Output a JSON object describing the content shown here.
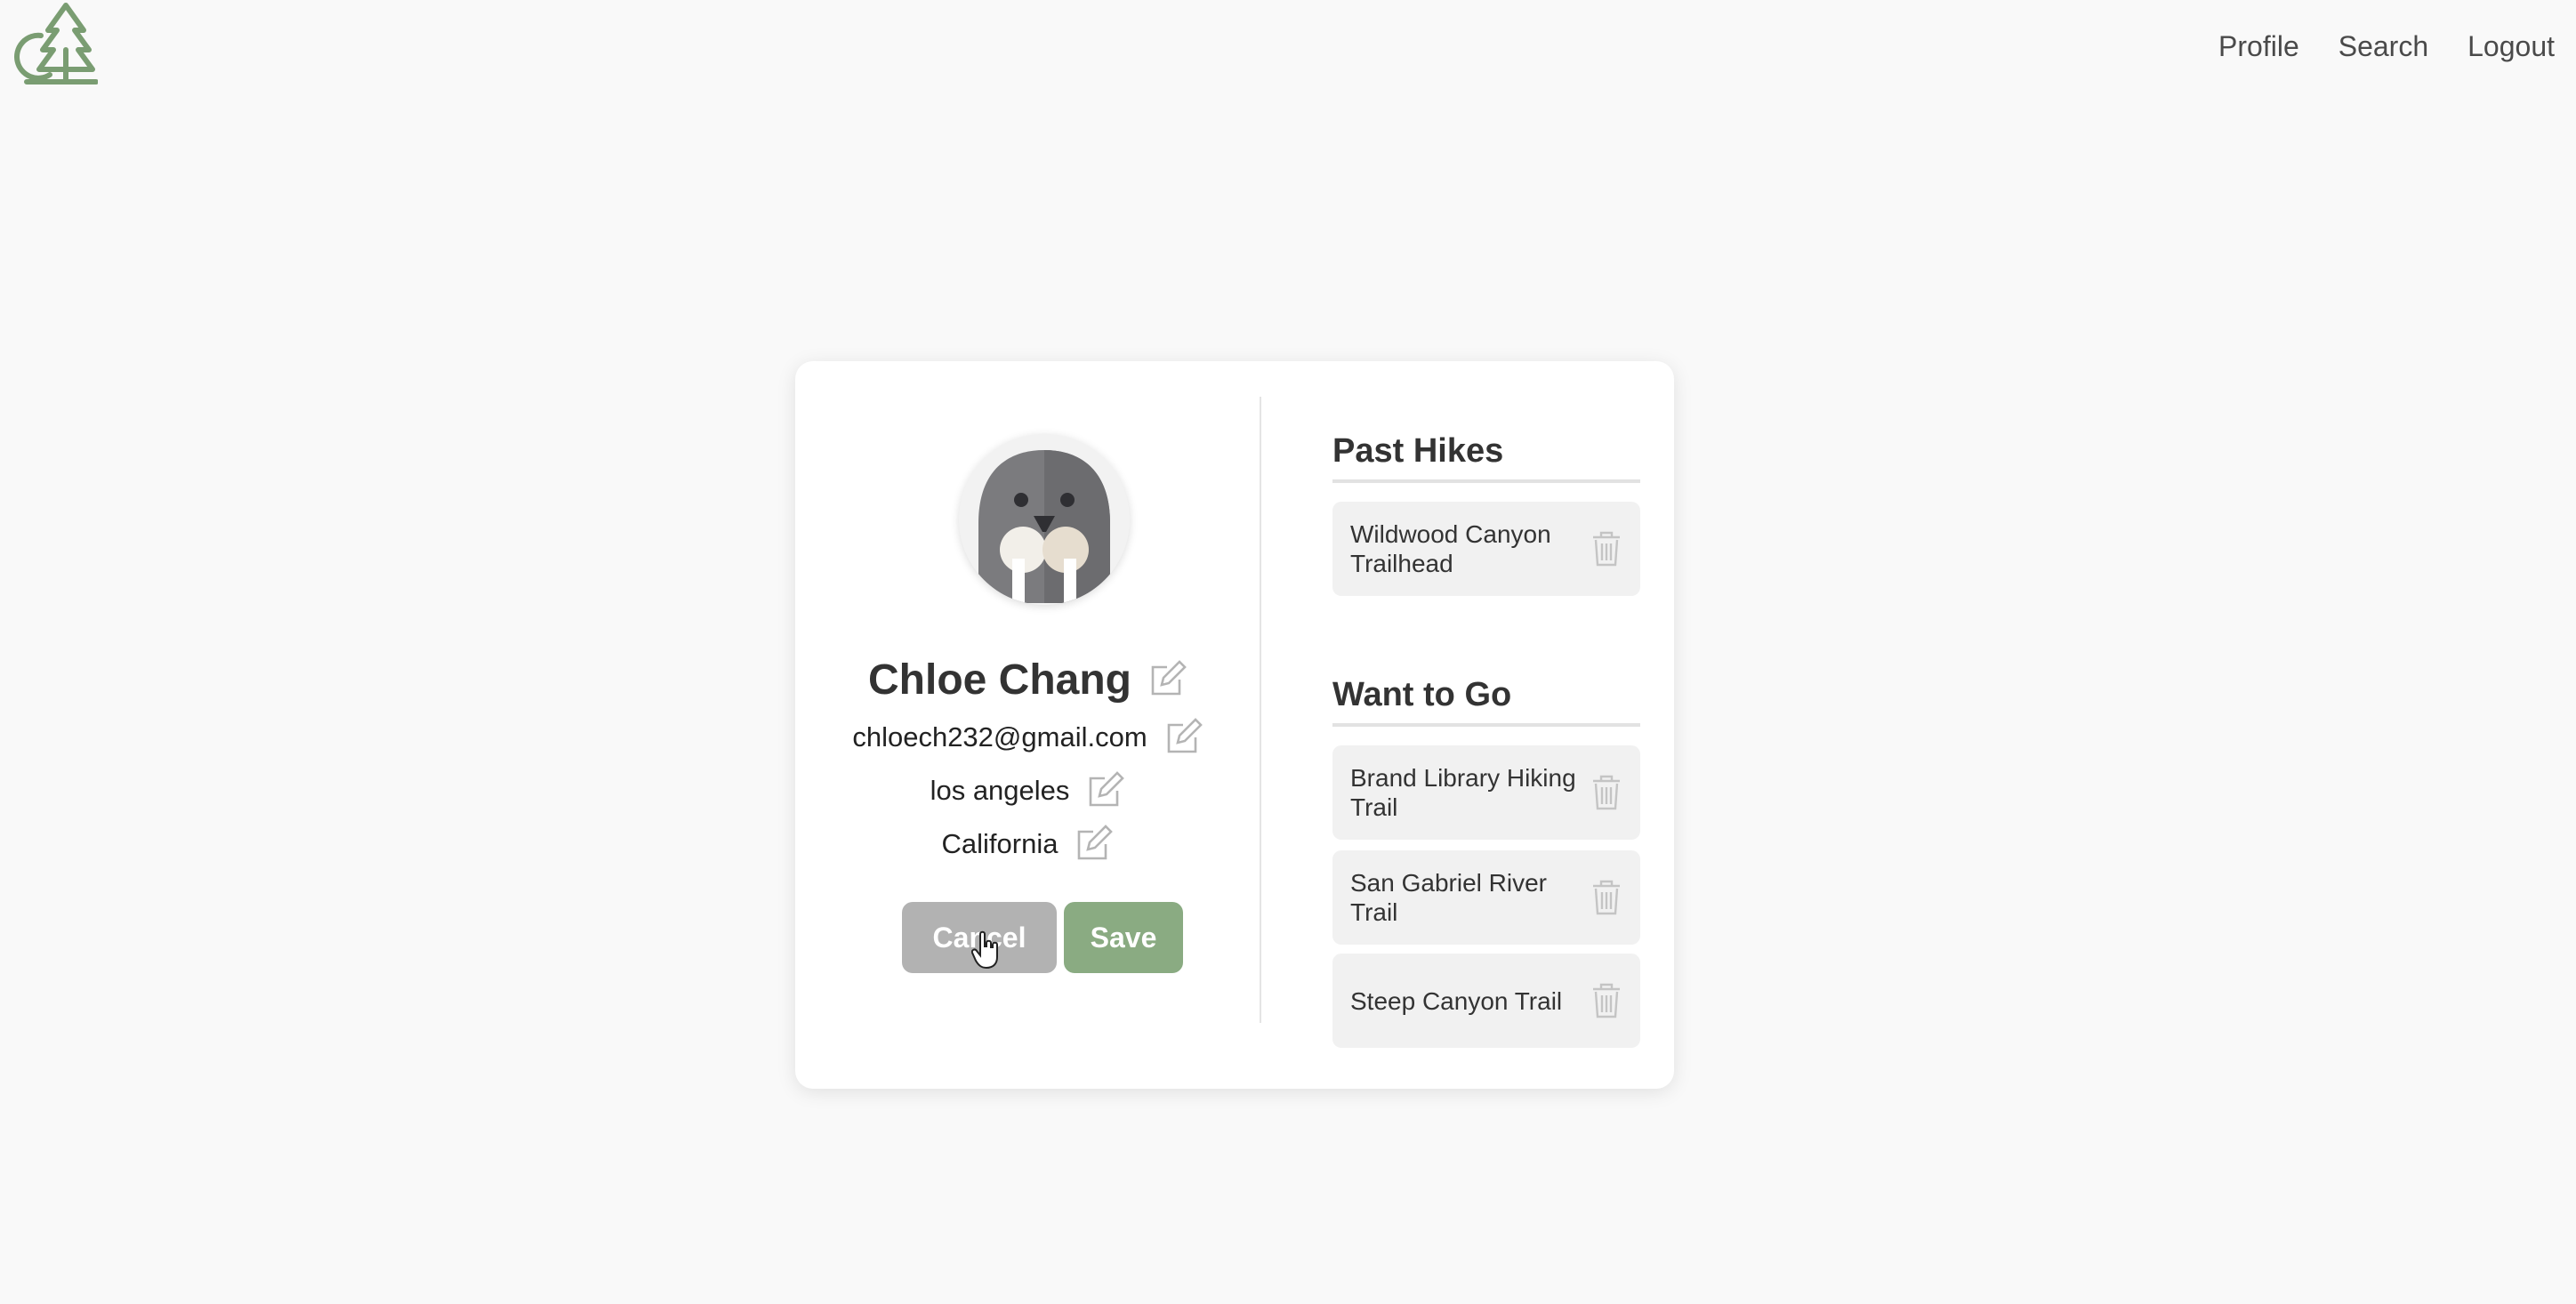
{
  "nav": {
    "links": [
      "Profile",
      "Search",
      "Logout"
    ]
  },
  "brand": {
    "logo_icon": "tree-logo-icon",
    "accent_color": "#7a9d72"
  },
  "profile": {
    "avatar_icon": "walrus-avatar",
    "name": "Chloe Chang",
    "email": "chloech232@gmail.com",
    "city": "los angeles",
    "state": "California",
    "edit_icon": "edit-icon"
  },
  "actions": {
    "cancel_label": "Cancel",
    "save_label": "Save",
    "cancel_color": "#b2b2b2",
    "save_color": "#8aab82"
  },
  "past_hikes": {
    "title": "Past Hikes",
    "items": [
      "Wildwood Canyon Trailhead"
    ]
  },
  "want_to_go": {
    "title": "Want to Go",
    "items": [
      "Brand Library Hiking Trail",
      "San Gabriel River Trail",
      "Steep Canyon Trail"
    ]
  }
}
